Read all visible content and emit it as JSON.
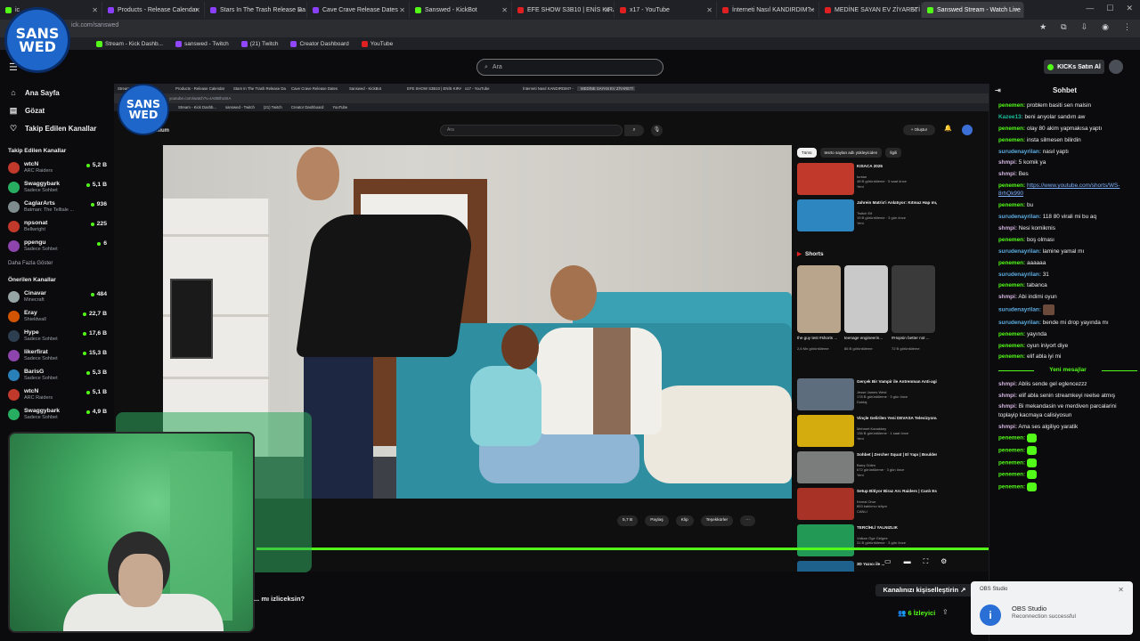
{
  "browser": {
    "tabs": [
      {
        "label": "ic",
        "color": "#53fc18"
      },
      {
        "label": "Products - Release Calendar",
        "color": "#8a3ffc"
      },
      {
        "label": "Stars In The Trash Release Da",
        "color": "#8a3ffc"
      },
      {
        "label": "Cave Crave Release Dates",
        "color": "#8a3ffc"
      },
      {
        "label": "Sanswed - KickBot",
        "color": "#53fc18"
      },
      {
        "label": "EFE SHOW S3B10 | ENİS KIRA",
        "color": "#e02020"
      },
      {
        "label": "x17 - YouTube",
        "color": "#e02020"
      },
      {
        "label": "İnterneti Nasıl KANDIRDIM? -",
        "color": "#e02020"
      },
      {
        "label": "MEDİNE SAYAN EV ZİYARETİ",
        "color": "#e02020"
      },
      {
        "label": "Sanswed Stream - Watch Live",
        "color": "#53fc18"
      }
    ],
    "url": "ick.com/sanswed",
    "bookmarks": [
      "Stream - Kick Dashb...",
      "sanswed - Twitch",
      "(21) Twitch",
      "Creator Dashboard",
      "YouTube"
    ]
  },
  "kick": {
    "search_placeholder": "Ara",
    "kicks_button": "KICKs Satın Al",
    "nav": [
      {
        "label": "Ana Sayfa",
        "icon": "home-icon"
      },
      {
        "label": "Gözat",
        "icon": "browse-icon"
      },
      {
        "label": "Takip Edilen Kanallar",
        "icon": "heart-icon"
      }
    ],
    "followed_title": "Takip Edilen Kanallar",
    "followed": [
      {
        "name": "wtcN",
        "sub": "ARC Raiders",
        "count": "5,2 B",
        "color": "#c0392b"
      },
      {
        "name": "Swaggybark",
        "sub": "Sadece Sohbet",
        "count": "5,1 B",
        "color": "#27ae60"
      },
      {
        "name": "CaglarArts",
        "sub": "Batman: The Telltale ...",
        "count": "936",
        "color": "#7f8c8d"
      },
      {
        "name": "npsonat",
        "sub": "Bellwright",
        "count": "225",
        "color": "#c0392b"
      },
      {
        "name": "ppengu",
        "sub": "Sadece Sohbet",
        "count": "6",
        "color": "#8e44ad"
      }
    ],
    "more_label": "Daha Fazla Göster",
    "recommended_title": "Önerilen Kanallar",
    "recommended": [
      {
        "name": "Cinavar",
        "sub": "Minecraft",
        "count": "484",
        "color": "#95a5a6"
      },
      {
        "name": "Eray",
        "sub": "Shieldwall",
        "count": "22,7 B",
        "color": "#d35400"
      },
      {
        "name": "Hype",
        "sub": "Sadece Sohbet",
        "count": "17,6 B",
        "color": "#2c3e50"
      },
      {
        "name": "likerfirat",
        "sub": "Sadece Sohbet",
        "count": "15,3 B",
        "color": "#8e44ad"
      },
      {
        "name": "BarisG",
        "sub": "Sadece Sohbet",
        "count": "5,3 B",
        "color": "#2980b9"
      },
      {
        "name": "wtcN",
        "sub": "ARC Raiders",
        "count": "5,1 B",
        "color": "#c0392b"
      },
      {
        "name": "Swaggybark",
        "sub": "Sadece Sohbet",
        "count": "4,9 B",
        "color": "#27ae60"
      }
    ],
    "question": "... mı izliceksin?",
    "customize_button": "Kanalınızı kişiselleştirin",
    "viewers": "6 İzleyici"
  },
  "logo": {
    "line1": "SANS",
    "line2": "WED"
  },
  "capture": {
    "tabs": [
      "Stream",
      "Products - Release Calendar",
      "Stars In The Trash Release Da",
      "Cave Crave Release Dates",
      "Sanswed - KickBot",
      "EFE SHOW S3B10 | ENİS KIRA",
      "x17 - YouTube",
      "İnterneti Nasıl KANDIRDIM? -",
      "MEDİNE SAYAN EV ZİYARETİ"
    ],
    "url": "youtube.com/watch?v=tAt0BhoSIA",
    "bookmarks": [
      "Stream - Kick Dashb...",
      "sanswed - Twitch",
      "(21) Twitch",
      "Creator Dashboard",
      "YouTube"
    ],
    "yt_logo": "mium",
    "search_placeholder": "Ara",
    "create_label": "+ Oluştur",
    "actions": [
      "5,7 B",
      "Paylaş",
      "Klip",
      "Teşekkürler",
      "···"
    ],
    "chips": [
      "Tümü",
      "tesrto saylan adlı yükleyiciden",
      "İlgili"
    ],
    "recs_top": [
      {
        "title": "KISACA 2025",
        "meta1": "tuntan",
        "meta2": "48 B görüntüleme · 5 saat önce",
        "badge": "Yeni",
        "color": "#c0392b"
      },
      {
        "title": "Jahrein Matrix'i Anlatıyor: Kıtmaz Hap mı, Mavi Hap mı ...",
        "meta1": "Twitch Eit",
        "meta2": "19 B görüntüleme · 3 gün önce",
        "badge": "Yeni",
        "color": "#2e86c1"
      }
    ],
    "shorts_title": "Shorts",
    "shorts": [
      {
        "title": "the guy test #shorts ...",
        "views": "2,6 Mn görüntüleme",
        "color": "#b9a48c"
      },
      {
        "title": "teenage engineerin...",
        "views": "86 B görüntüleme",
        "color": "#c9c9c9"
      },
      {
        "title": "#Hopsin better not ...",
        "views": "72 B görüntüleme",
        "color": "#3a3a3a"
      }
    ],
    "recs_bottom": [
      {
        "title": "Gerçek Bir Vampir ile Antrenman Anti-aging",
        "meta1": "Jesse James West",
        "meta2": "178 B görüntüleme · 3 gün önce",
        "badge": "Dublaj",
        "color": "#5d6d7e"
      },
      {
        "title": "Vinçle Gelirilen Yeni DEVASA Televizyonum!",
        "meta1": "Mehmet Kanakkey",
        "meta2": "136 B görüntüleme · 1 saat önce",
        "badge": "Yeni",
        "color": "#d4ac0d"
      },
      {
        "title": "Sohbet | Zercher Squat | El Yapı | Bouldering | Pinch Grip ...",
        "meta1": "Barış Gülen",
        "meta2": "672 görüntüleme · 3 gün önce",
        "badge": "Yeni",
        "color": "#7b7d7d"
      },
      {
        "title": "Setup Bitiyor Biraz Arc Raiders | Canlı Esnaf Ziyareti",
        "meta1": "Kemal Onur",
        "meta2": "853 katılımcı izliyor",
        "badge": "CANLI",
        "color": "#a93226"
      },
      {
        "title": "TERCİHLİ YALNIZLIK",
        "meta1": "Volkan Öge Gelgee",
        "meta2": "31 B görüntüleme · 3 gün önce",
        "badge": "Yeni",
        "color": "#229954"
      },
      {
        "title": "3D Yazıcı ile ...",
        "meta1": "Makerbaşı",
        "meta2": "",
        "badge": "",
        "color": "#1f618d"
      }
    ]
  },
  "chat": {
    "title": "Sohbet",
    "messages": [
      {
        "user": "penemen:",
        "text": "problem basiti sen malsin",
        "color": "#53fc18"
      },
      {
        "user": "Kazee13:",
        "text": "beni arıyolar sandım aw",
        "color": "#1abc9c"
      },
      {
        "user": "penemen:",
        "text": "olay 80 akim yapmakısa yaptı",
        "color": "#53fc18"
      },
      {
        "user": "penemen:",
        "text": "insta silmesen bilirdin",
        "color": "#53fc18"
      },
      {
        "user": "surudenayrilan:",
        "text": "nasıl yaptı",
        "color": "#5dade2"
      },
      {
        "user": "shmpi:",
        "text": "5 komik ya",
        "color": "#d2b4de"
      },
      {
        "user": "shmpi:",
        "text": "Bes",
        "color": "#d2b4de"
      },
      {
        "user": "penemen:",
        "text": "",
        "url": "https://www.youtube.com/shorts/WS-8rhQk990",
        "color": "#53fc18"
      },
      {
        "user": "penemen:",
        "text": "bu",
        "color": "#53fc18"
      },
      {
        "user": "surudenayrilan:",
        "text": "118 80 virali mi bu aq",
        "color": "#5dade2"
      },
      {
        "user": "shmpi:",
        "text": "Nesi komikmis",
        "color": "#d2b4de"
      },
      {
        "user": "penemen:",
        "text": "boş olması",
        "color": "#53fc18"
      },
      {
        "user": "surudenayrilan:",
        "text": "lamine yamal mı",
        "color": "#5dade2"
      },
      {
        "user": "penemen:",
        "text": "aaaaaa",
        "color": "#53fc18"
      },
      {
        "user": "surudenayrilan:",
        "text": "31",
        "color": "#5dade2"
      },
      {
        "user": "penemen:",
        "text": "tabanca",
        "color": "#53fc18"
      },
      {
        "user": "shmpi:",
        "text": "Abi indimi oyun",
        "color": "#d2b4de"
      },
      {
        "user": "surudenayrilan:",
        "text": "",
        "emote": "image",
        "color": "#5dade2"
      },
      {
        "user": "surudenayrilan:",
        "text": "bende mi drop yayında mı",
        "color": "#5dade2"
      },
      {
        "user": "penemen:",
        "text": "yayında",
        "color": "#53fc18"
      },
      {
        "user": "penemen:",
        "text": "oyun iniyort diye",
        "color": "#53fc18"
      },
      {
        "user": "penemen:",
        "text": "elif abla iyi mi",
        "color": "#53fc18"
      }
    ],
    "new_label": "Yeni mesajlar",
    "new_messages": [
      {
        "user": "shmpi:",
        "text": "Ablis sende gel eglencezzz",
        "color": "#d2b4de"
      },
      {
        "user": "shmpi:",
        "text": "elif abla senin streamkeyi reelse atmış",
        "color": "#d2b4de"
      },
      {
        "user": "shmpi:",
        "text": "Bi mekandasin ve merdiven parcalarini toplayip kacmaya calisiyosun",
        "color": "#d2b4de"
      },
      {
        "user": "shmpi:",
        "text": "Ama ses algiliyo yaratik",
        "color": "#d2b4de"
      },
      {
        "user": "penemen:",
        "text": "",
        "emote": "green",
        "color": "#53fc18"
      },
      {
        "user": "penemen:",
        "text": "",
        "emote": "green",
        "color": "#53fc18"
      },
      {
        "user": "penemen:",
        "text": "",
        "emote": "green",
        "color": "#53fc18"
      },
      {
        "user": "penemen:",
        "text": "",
        "emote": "green",
        "color": "#53fc18"
      },
      {
        "user": "penemen:",
        "text": "",
        "emote": "green",
        "color": "#53fc18"
      }
    ]
  },
  "obs": {
    "app": "OBS Studio",
    "title": "OBS Studio",
    "message": "Reconnection successful"
  },
  "colors": {
    "kick_green": "#53fc18",
    "youtube_red": "#e02020",
    "background": "#0b0b0d"
  }
}
